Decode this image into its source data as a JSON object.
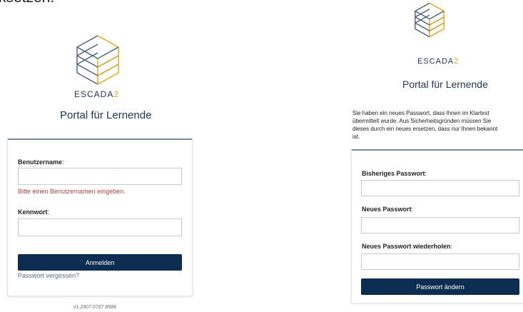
{
  "fragment": {
    "text": "ksetzen."
  },
  "logo": {
    "brand": "ESCADA",
    "suffix": "2"
  },
  "portal": {
    "title": "Portal für Lernende"
  },
  "login": {
    "username_label": "Benutzername",
    "username_value": "",
    "username_error": "Bitte einen Benutzernamen eingeben.",
    "password_label": "Kennwort",
    "password_value": "",
    "submit_label": "Anmelden",
    "forgot_label": "Passwort vergessen?",
    "version": "v1.2307.0707.8588"
  },
  "change_password": {
    "info_lines": [
      "Sie haben ein neues Passwort, dass Ihnen im Klartext",
      "übermittelt wurde. Aus Sicherheitsgründen müssen Sie",
      "dieses durch ein neues ersetzen, dass nur Ihnen bekannt",
      "ist."
    ],
    "old_label": "Bisheriges Passwort",
    "new_label": "Neues Passwort",
    "repeat_label": "Neues Passwort wiederholen",
    "submit_label": "Passwort ändern"
  },
  "colors": {
    "primary": "#0c2d52",
    "accent": "#e2a321",
    "logo_line": "#4a5f7d",
    "error": "#a94442",
    "title": "#1f3550"
  }
}
